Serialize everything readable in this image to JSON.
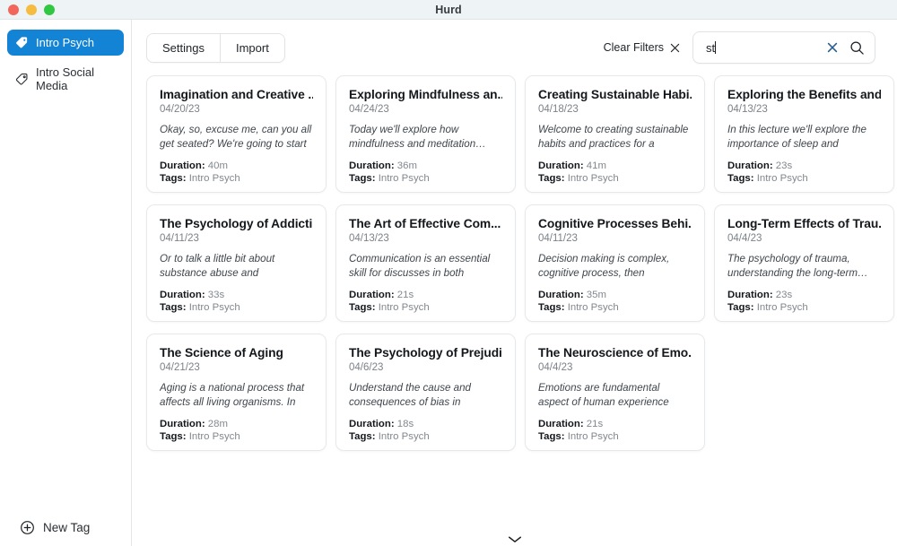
{
  "window": {
    "title": "Hurd",
    "traffic_lights": [
      {
        "name": "close",
        "color": "#f2675a"
      },
      {
        "name": "minimize",
        "color": "#f6bc40"
      },
      {
        "name": "zoom",
        "color": "#30c742"
      }
    ]
  },
  "sidebar": {
    "items": [
      {
        "label": "Intro Psych",
        "icon": "tag-icon",
        "active": true
      },
      {
        "label": "Intro Social Media",
        "icon": "tag-icon",
        "active": false
      }
    ],
    "new_tag": {
      "label": "New Tag",
      "icon": "plus-circle-icon"
    }
  },
  "toolbar": {
    "settings_label": "Settings",
    "import_label": "Import",
    "clear_filters_label": "Clear Filters",
    "clear_filters_icon": "close-x-icon"
  },
  "search": {
    "value": "st",
    "placeholder": "",
    "clear_icon": "clear-x-icon",
    "search_icon": "search-icon"
  },
  "labels": {
    "duration": "Duration:",
    "tags": "Tags:"
  },
  "accent_color": "#1383d6",
  "cards": [
    {
      "title": "Imagination and Creative ...",
      "date": "04/20/23",
      "snippet": "Okay, so, excuse me, can you all get seated? We're going to start i…",
      "duration": "40m",
      "tags": "Intro Psych"
    },
    {
      "title": "Exploring Mindfulness an...",
      "date": "04/24/23",
      "snippet": "Today we'll explore how mindfulness and meditation…",
      "duration": "36m",
      "tags": "Intro Psych"
    },
    {
      "title": "Creating Sustainable Habi...",
      "date": "04/18/23",
      "snippet": "Welcome to creating sustainable habits and practices for a happy…",
      "duration": "41m",
      "tags": "Intro Psych"
    },
    {
      "title": "Exploring the Benefits and...",
      "date": "04/13/23",
      "snippet": "In this lecture we'll explore the importance of sleep and various…",
      "duration": "23s",
      "tags": "Intro Psych"
    },
    {
      "title": "The Psychology of Addicti...",
      "date": "04/11/23",
      "snippet": "Or to talk a little bit about substance abuse and behavioral…",
      "duration": "33s",
      "tags": "Intro Psych"
    },
    {
      "title": "The Art of Effective Com...",
      "date": "04/13/23",
      "snippet": "Communication is an essential skill for discusses in both personal an…",
      "duration": "21s",
      "tags": "Intro Psych"
    },
    {
      "title": "Cognitive Processes Behi...",
      "date": "04/11/23",
      "snippet": "Decision making is complex, cognitive process, then involves…",
      "duration": "35m",
      "tags": "Intro Psych"
    },
    {
      "title": "Long-Term Effects of Trau...",
      "date": "04/4/23",
      "snippet": "The psychology of trauma, understanding the long-term…",
      "duration": "23s",
      "tags": "Intro Psych"
    },
    {
      "title": "The Science of Aging",
      "date": "04/21/23",
      "snippet": "Aging is a national process that affects all living organisms. In thi…",
      "duration": "28m",
      "tags": "Intro Psych"
    },
    {
      "title": "The Psychology of Prejudi...",
      "date": "04/6/23",
      "snippet": "Understand the cause and consequences of bias in prejudic…",
      "duration": "18s",
      "tags": "Intro Psych"
    },
    {
      "title": "The Neuroscience of Emo...",
      "date": "04/4/23",
      "snippet": "Emotions are fundamental aspect of human experience influencing…",
      "duration": "21s",
      "tags": "Intro Psych"
    }
  ],
  "footer": {
    "scroll_down_icon": "chevron-down-icon"
  }
}
